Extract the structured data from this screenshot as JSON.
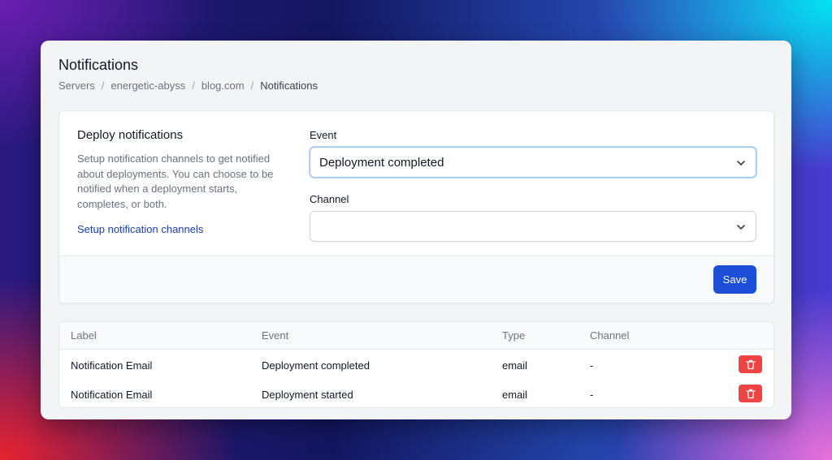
{
  "page": {
    "title": "Notifications",
    "breadcrumb": [
      "Servers",
      "energetic-abyss",
      "blog.com",
      "Notifications"
    ]
  },
  "deploy_card": {
    "title": "Deploy notifications",
    "description_lines": [
      "Setup notification channels to get notified",
      "about deployments. You can choose to be",
      "notified when a deployment starts,",
      "completes, or both."
    ],
    "link": "Setup notification channels",
    "event_label": "Event",
    "event_value": "Deployment completed",
    "channel_label": "Channel",
    "channel_value": "",
    "save_label": "Save"
  },
  "table": {
    "headers": [
      "Label",
      "Event",
      "Type",
      "Channel"
    ],
    "rows": [
      {
        "label": "Notification Email",
        "event": "Deployment completed",
        "type": "email",
        "channel": "-"
      },
      {
        "label": "Notification Email",
        "event": "Deployment started",
        "type": "email",
        "channel": "-"
      }
    ]
  },
  "icons": {
    "select_chevron": "chevron-down-icon",
    "delete": "trash-icon"
  },
  "colors": {
    "primary": "#1d4ed8",
    "danger": "#ef4444",
    "link": "#1e40af"
  }
}
